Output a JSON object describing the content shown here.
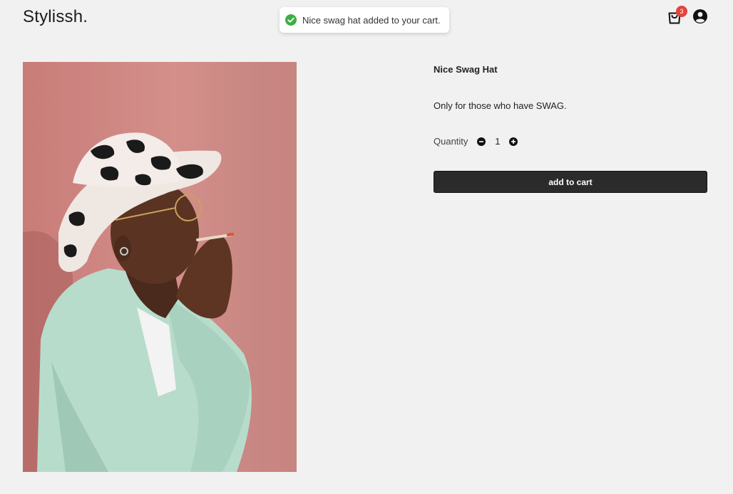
{
  "brand": {
    "logo_text": "Stylissh."
  },
  "toast": {
    "icon": "check-circle-icon",
    "message": "Nice swag hat added to your cart.",
    "accent": "#3cb043"
  },
  "header": {
    "cart": {
      "icon": "shopping-bag-icon",
      "badge_count": "3",
      "badge_color": "#e4433d"
    },
    "account": {
      "icon": "user-circle-icon"
    }
  },
  "product": {
    "title": "Nice Swag Hat",
    "description": "Only for those who have SWAG.",
    "quantity_label": "Quantity",
    "quantity_value": "1",
    "add_button_label": "add to cart"
  },
  "colors": {
    "background": "#f1f1f1",
    "button": "#2b2b2b"
  }
}
